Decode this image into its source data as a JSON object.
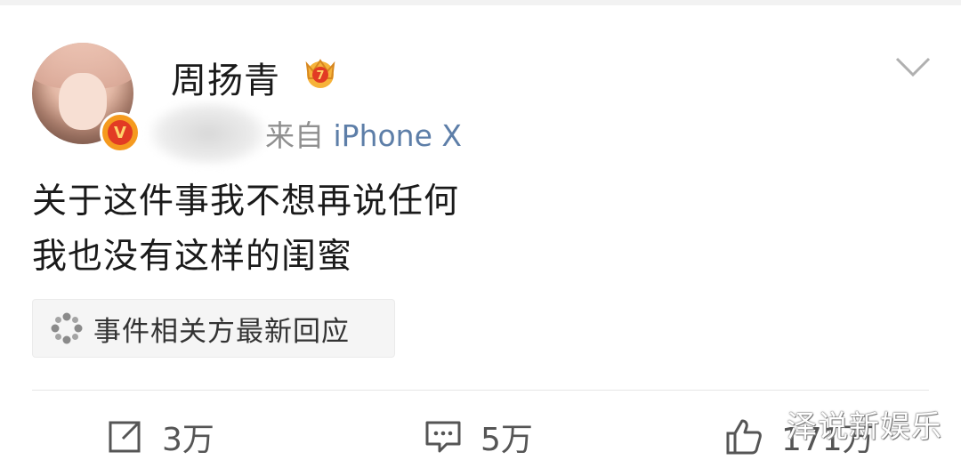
{
  "post": {
    "author": {
      "name": "周扬青",
      "verified_badge": "V"
    },
    "source_prefix": "来自",
    "source_device": "iPhone X",
    "content_lines": [
      "关于这件事我不想再说任何",
      "我也没有这样的闺蜜"
    ],
    "topic_chip": {
      "label": "事件相关方最新回应",
      "icon": "sparkle-icon"
    },
    "actions": {
      "repost": {
        "icon": "share-icon",
        "count": "3万"
      },
      "comment": {
        "icon": "comment-icon",
        "count": "5万"
      },
      "like": {
        "icon": "thumbs-up-icon",
        "count": "171万"
      }
    }
  },
  "watermark": "泽说新娱乐",
  "colors": {
    "source_device": "#5d7ea8",
    "badge_orange": "#f59a1f",
    "badge_red": "#e23b24",
    "crown_gold": "#f6b33a"
  }
}
